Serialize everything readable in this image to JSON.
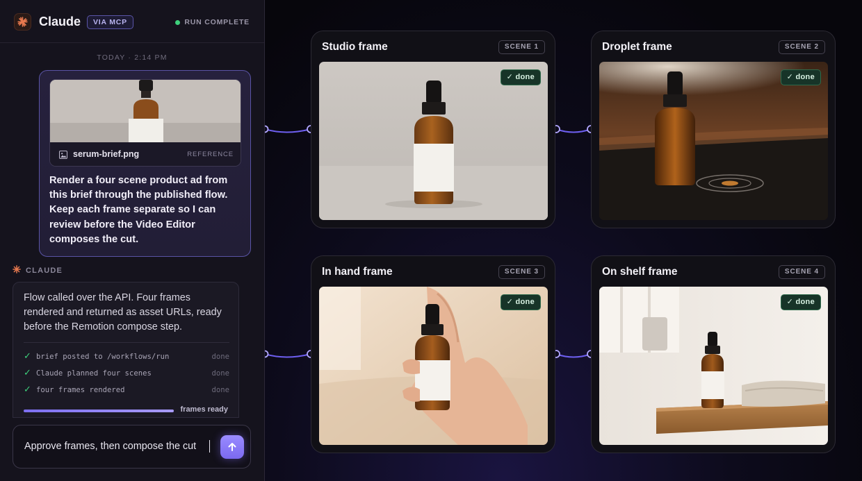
{
  "app": {
    "title": "Claude",
    "badge": "VIA MCP",
    "status": "RUN COMPLETE",
    "status_color": "#3ed07c",
    "accent": "#7b6af0"
  },
  "chat": {
    "timestamp": "TODAY · 2:14 PM",
    "attachment": {
      "filename": "serum-brief.png",
      "tag": "REFERENCE",
      "icon": "image-icon"
    },
    "user_message": "Render a four scene product ad from this brief through the published flow. Keep each frame separate so I can review before the Video Editor composes the cut.",
    "assistant_label": "CLAUDE",
    "assistant_message": "Flow called over the API. Four frames rendered and returned as asset URLs, ready before the Remotion compose step.",
    "steps": [
      {
        "text": "brief posted to /workflows/run",
        "status": "done"
      },
      {
        "text": "Claude planned four scenes",
        "status": "done"
      },
      {
        "text": "four frames rendered",
        "status": "done"
      }
    ],
    "progress": {
      "label": "frames ready",
      "fraction": 1.0
    }
  },
  "composer": {
    "value": "Approve frames, then compose the cut",
    "send_icon": "arrow-up-icon"
  },
  "scenes": [
    {
      "title": "Studio frame",
      "tag": "SCENE 1",
      "status": "✓ done"
    },
    {
      "title": "Droplet frame",
      "tag": "SCENE 2",
      "status": "✓ done"
    },
    {
      "title": "In hand frame",
      "tag": "SCENE 3",
      "status": "✓ done"
    },
    {
      "title": "On shelf frame",
      "tag": "SCENE 4",
      "status": "✓ done"
    }
  ]
}
